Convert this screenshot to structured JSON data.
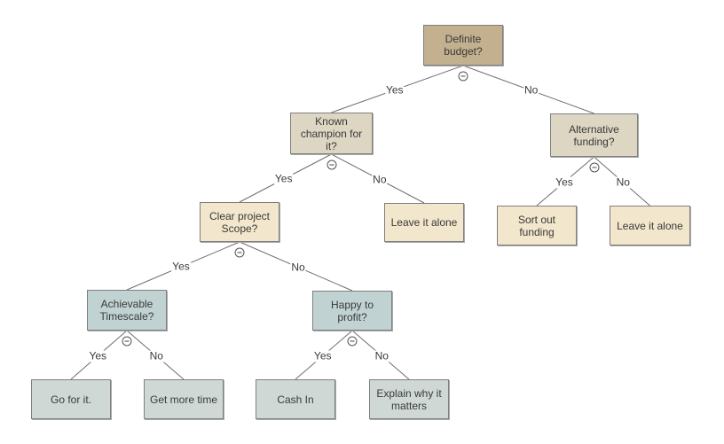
{
  "diagram": {
    "type": "decision-tree",
    "colors": {
      "root": "#c3b08e",
      "level1": "#ddd6c3",
      "tan_leaf": "#f2e6cc",
      "blue_decision": "#c0d2d2",
      "grey_leaf": "#cfd8d4",
      "edge": "#6e6e6e"
    },
    "nodes": [
      {
        "id": "definite-budget",
        "label": "Definite budget?",
        "style": "root"
      },
      {
        "id": "known-champion",
        "label": "Known champion for it?",
        "style": "level1"
      },
      {
        "id": "alternative-funding",
        "label": "Alternative funding?",
        "style": "level1"
      },
      {
        "id": "clear-project-scope",
        "label": "Clear project Scope?",
        "style": "tan_leaf"
      },
      {
        "id": "leave-it-alone-1",
        "label": "Leave it alone",
        "style": "tan_leaf"
      },
      {
        "id": "sort-out-funding",
        "label": "Sort out funding",
        "style": "tan_leaf"
      },
      {
        "id": "leave-it-alone-2",
        "label": "Leave it alone",
        "style": "tan_leaf"
      },
      {
        "id": "achievable-timescale",
        "label": "Achievable Timescale?",
        "style": "blue_decision"
      },
      {
        "id": "happy-to-profit",
        "label": "Happy to profit?",
        "style": "blue_decision"
      },
      {
        "id": "go-for-it",
        "label": "Go for it.",
        "style": "grey_leaf"
      },
      {
        "id": "get-more-time",
        "label": "Get more time",
        "style": "grey_leaf"
      },
      {
        "id": "cash-in",
        "label": "Cash In",
        "style": "grey_leaf"
      },
      {
        "id": "explain-why-it-matters",
        "label": "Explain why it matters",
        "style": "grey_leaf"
      }
    ],
    "edges": [
      {
        "from": "definite-budget",
        "to": "known-champion",
        "label": "Yes"
      },
      {
        "from": "definite-budget",
        "to": "alternative-funding",
        "label": "No"
      },
      {
        "from": "known-champion",
        "to": "clear-project-scope",
        "label": "Yes"
      },
      {
        "from": "known-champion",
        "to": "leave-it-alone-1",
        "label": "No"
      },
      {
        "from": "alternative-funding",
        "to": "sort-out-funding",
        "label": "Yes"
      },
      {
        "from": "alternative-funding",
        "to": "leave-it-alone-2",
        "label": "No"
      },
      {
        "from": "clear-project-scope",
        "to": "achievable-timescale",
        "label": "Yes"
      },
      {
        "from": "clear-project-scope",
        "to": "happy-to-profit",
        "label": "No"
      },
      {
        "from": "achievable-timescale",
        "to": "go-for-it",
        "label": "Yes"
      },
      {
        "from": "achievable-timescale",
        "to": "get-more-time",
        "label": "No"
      },
      {
        "from": "happy-to-profit",
        "to": "cash-in",
        "label": "Yes"
      },
      {
        "from": "happy-to-profit",
        "to": "explain-why-it-matters",
        "label": "No"
      }
    ],
    "collapse_icon": "collapse-minus-icon"
  }
}
